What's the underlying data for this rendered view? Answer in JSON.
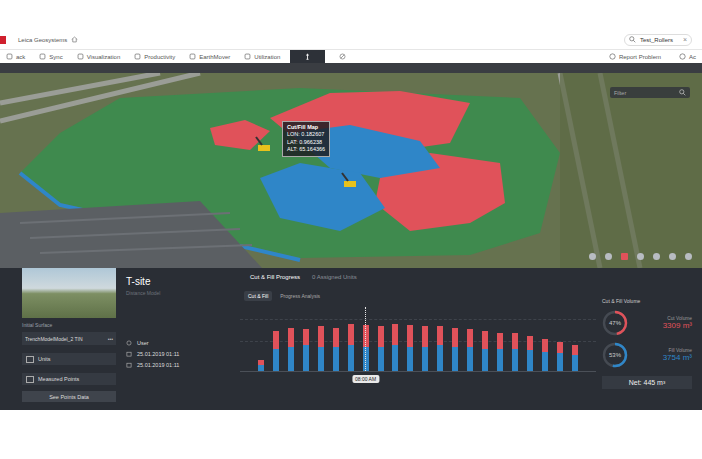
{
  "header": {
    "brand": "Leica Geosystems",
    "search": {
      "value": "Test_Rollers",
      "clear": "×"
    }
  },
  "nav": [
    {
      "label": "ack",
      "kind": "text",
      "selected": false
    },
    {
      "label": "Sync",
      "kind": "text",
      "selected": false
    },
    {
      "label": "Visualization",
      "kind": "text",
      "selected": false
    },
    {
      "label": "Productivity",
      "kind": "text",
      "selected": false
    },
    {
      "label": "EarthMover",
      "kind": "text",
      "selected": false
    },
    {
      "label": "Utilization",
      "kind": "text",
      "selected": false
    },
    {
      "label": "",
      "kind": "icon",
      "selected": true
    },
    {
      "label": "",
      "kind": "icon",
      "selected": false
    }
  ],
  "nav_actions": [
    "Report Problem",
    "Ac"
  ],
  "map": {
    "filter_placeholder": "Filter",
    "tooltip": {
      "title": "Cut/Fill Map",
      "lines": [
        "LON: 0.182607",
        "LAT: 0.966238",
        "ALT: 65.164366"
      ]
    }
  },
  "site": {
    "name": "T-site",
    "subtitle": "Distance Model",
    "initial_surface_label": "Initial Surface",
    "surface": "TrenchModelModel_2 TIN",
    "more": "•••",
    "rows": [
      "Units",
      "Measured Points"
    ],
    "button": "See Points Data"
  },
  "info": {
    "user": "User",
    "dates": [
      "25.01.2019 01:11",
      "25.01.2019 01:11"
    ]
  },
  "tabs": [
    {
      "label": "Cut & Fill Progress",
      "selected": true
    },
    {
      "label": "0 Assigned Units",
      "selected": false
    }
  ],
  "subtabs": [
    {
      "label": "Cut & Fill",
      "selected": true
    },
    {
      "label": "Progress Analysis",
      "selected": false
    }
  ],
  "chart": {
    "series": [
      {
        "color": "#e0525a",
        "values": [
          6,
          22,
          24,
          20,
          26,
          24,
          26,
          28,
          26,
          26,
          28,
          26,
          24,
          24,
          22,
          22,
          20,
          20,
          18,
          16,
          14,
          12
        ]
      },
      {
        "color": "#2f86c8",
        "values": [
          8,
          28,
          30,
          32,
          30,
          30,
          32,
          30,
          30,
          32,
          30,
          30,
          32,
          30,
          30,
          28,
          28,
          28,
          26,
          24,
          22,
          20
        ]
      }
    ],
    "selected_index": 7,
    "selected_label": "08:00 AM"
  },
  "volume": {
    "title": "Cut & Fill Volume",
    "items": [
      {
        "label": "Cut Volume",
        "percent": "47%",
        "level": 0.47,
        "value": "3309 m³",
        "color": "#e0525a"
      },
      {
        "label": "Fill Volume",
        "percent": "53%",
        "level": 0.53,
        "value": "3754 m³",
        "color": "#2f86c8"
      }
    ],
    "net": "Net: 445 m³"
  }
}
